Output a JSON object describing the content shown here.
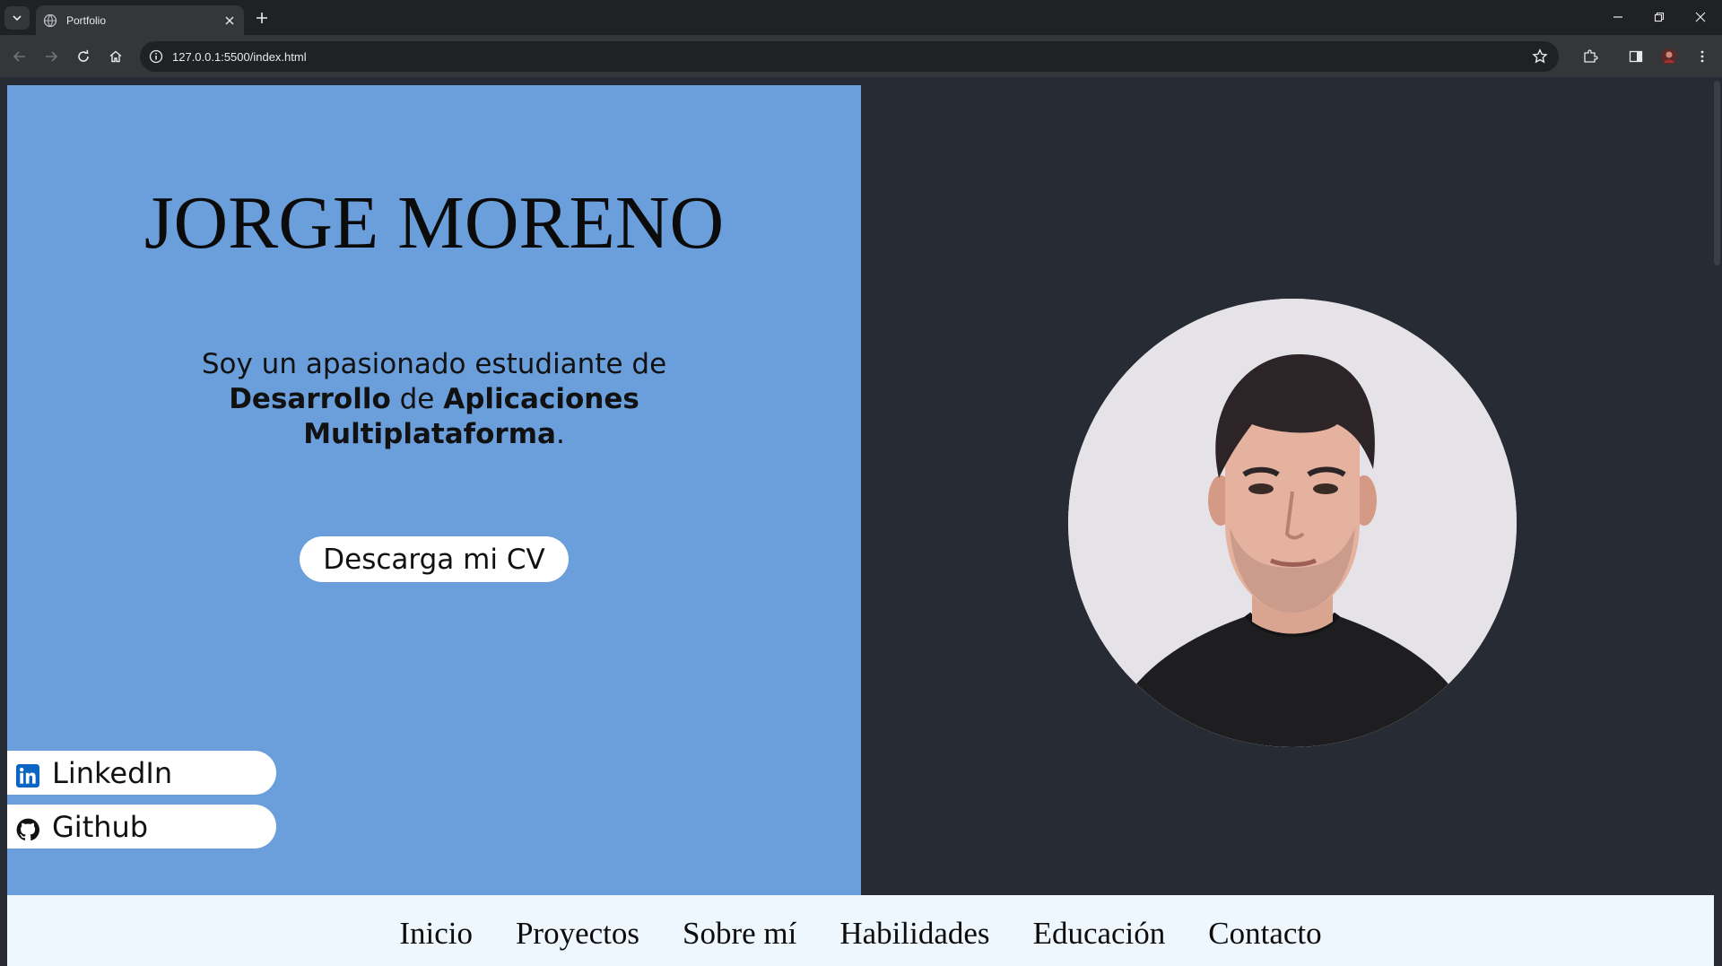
{
  "browser": {
    "tab_title": "Portfolio",
    "url": "127.0.0.1:5500/index.html",
    "accent": "#35363a"
  },
  "hero": {
    "name": "JORGE MORENO",
    "intro_prefix": "Soy un apasionado estudiante de ",
    "intro_bold1": "Desarrollo",
    "intro_mid": " de ",
    "intro_bold2": "Aplicaciones Multiplataforma",
    "intro_suffix": ".",
    "cv_button": "Descarga mi CV",
    "left_bg": "#6b9fdc",
    "right_bg": "#272b34"
  },
  "social": [
    {
      "label": "LinkedIn",
      "icon": "linkedin-icon"
    },
    {
      "label": "Github",
      "icon": "github-icon"
    }
  ],
  "nav": {
    "items": [
      "Inicio",
      "Proyectos",
      "Sobre mí",
      "Habilidades",
      "Educación",
      "Contacto"
    ],
    "bg": "#eef6fe"
  }
}
